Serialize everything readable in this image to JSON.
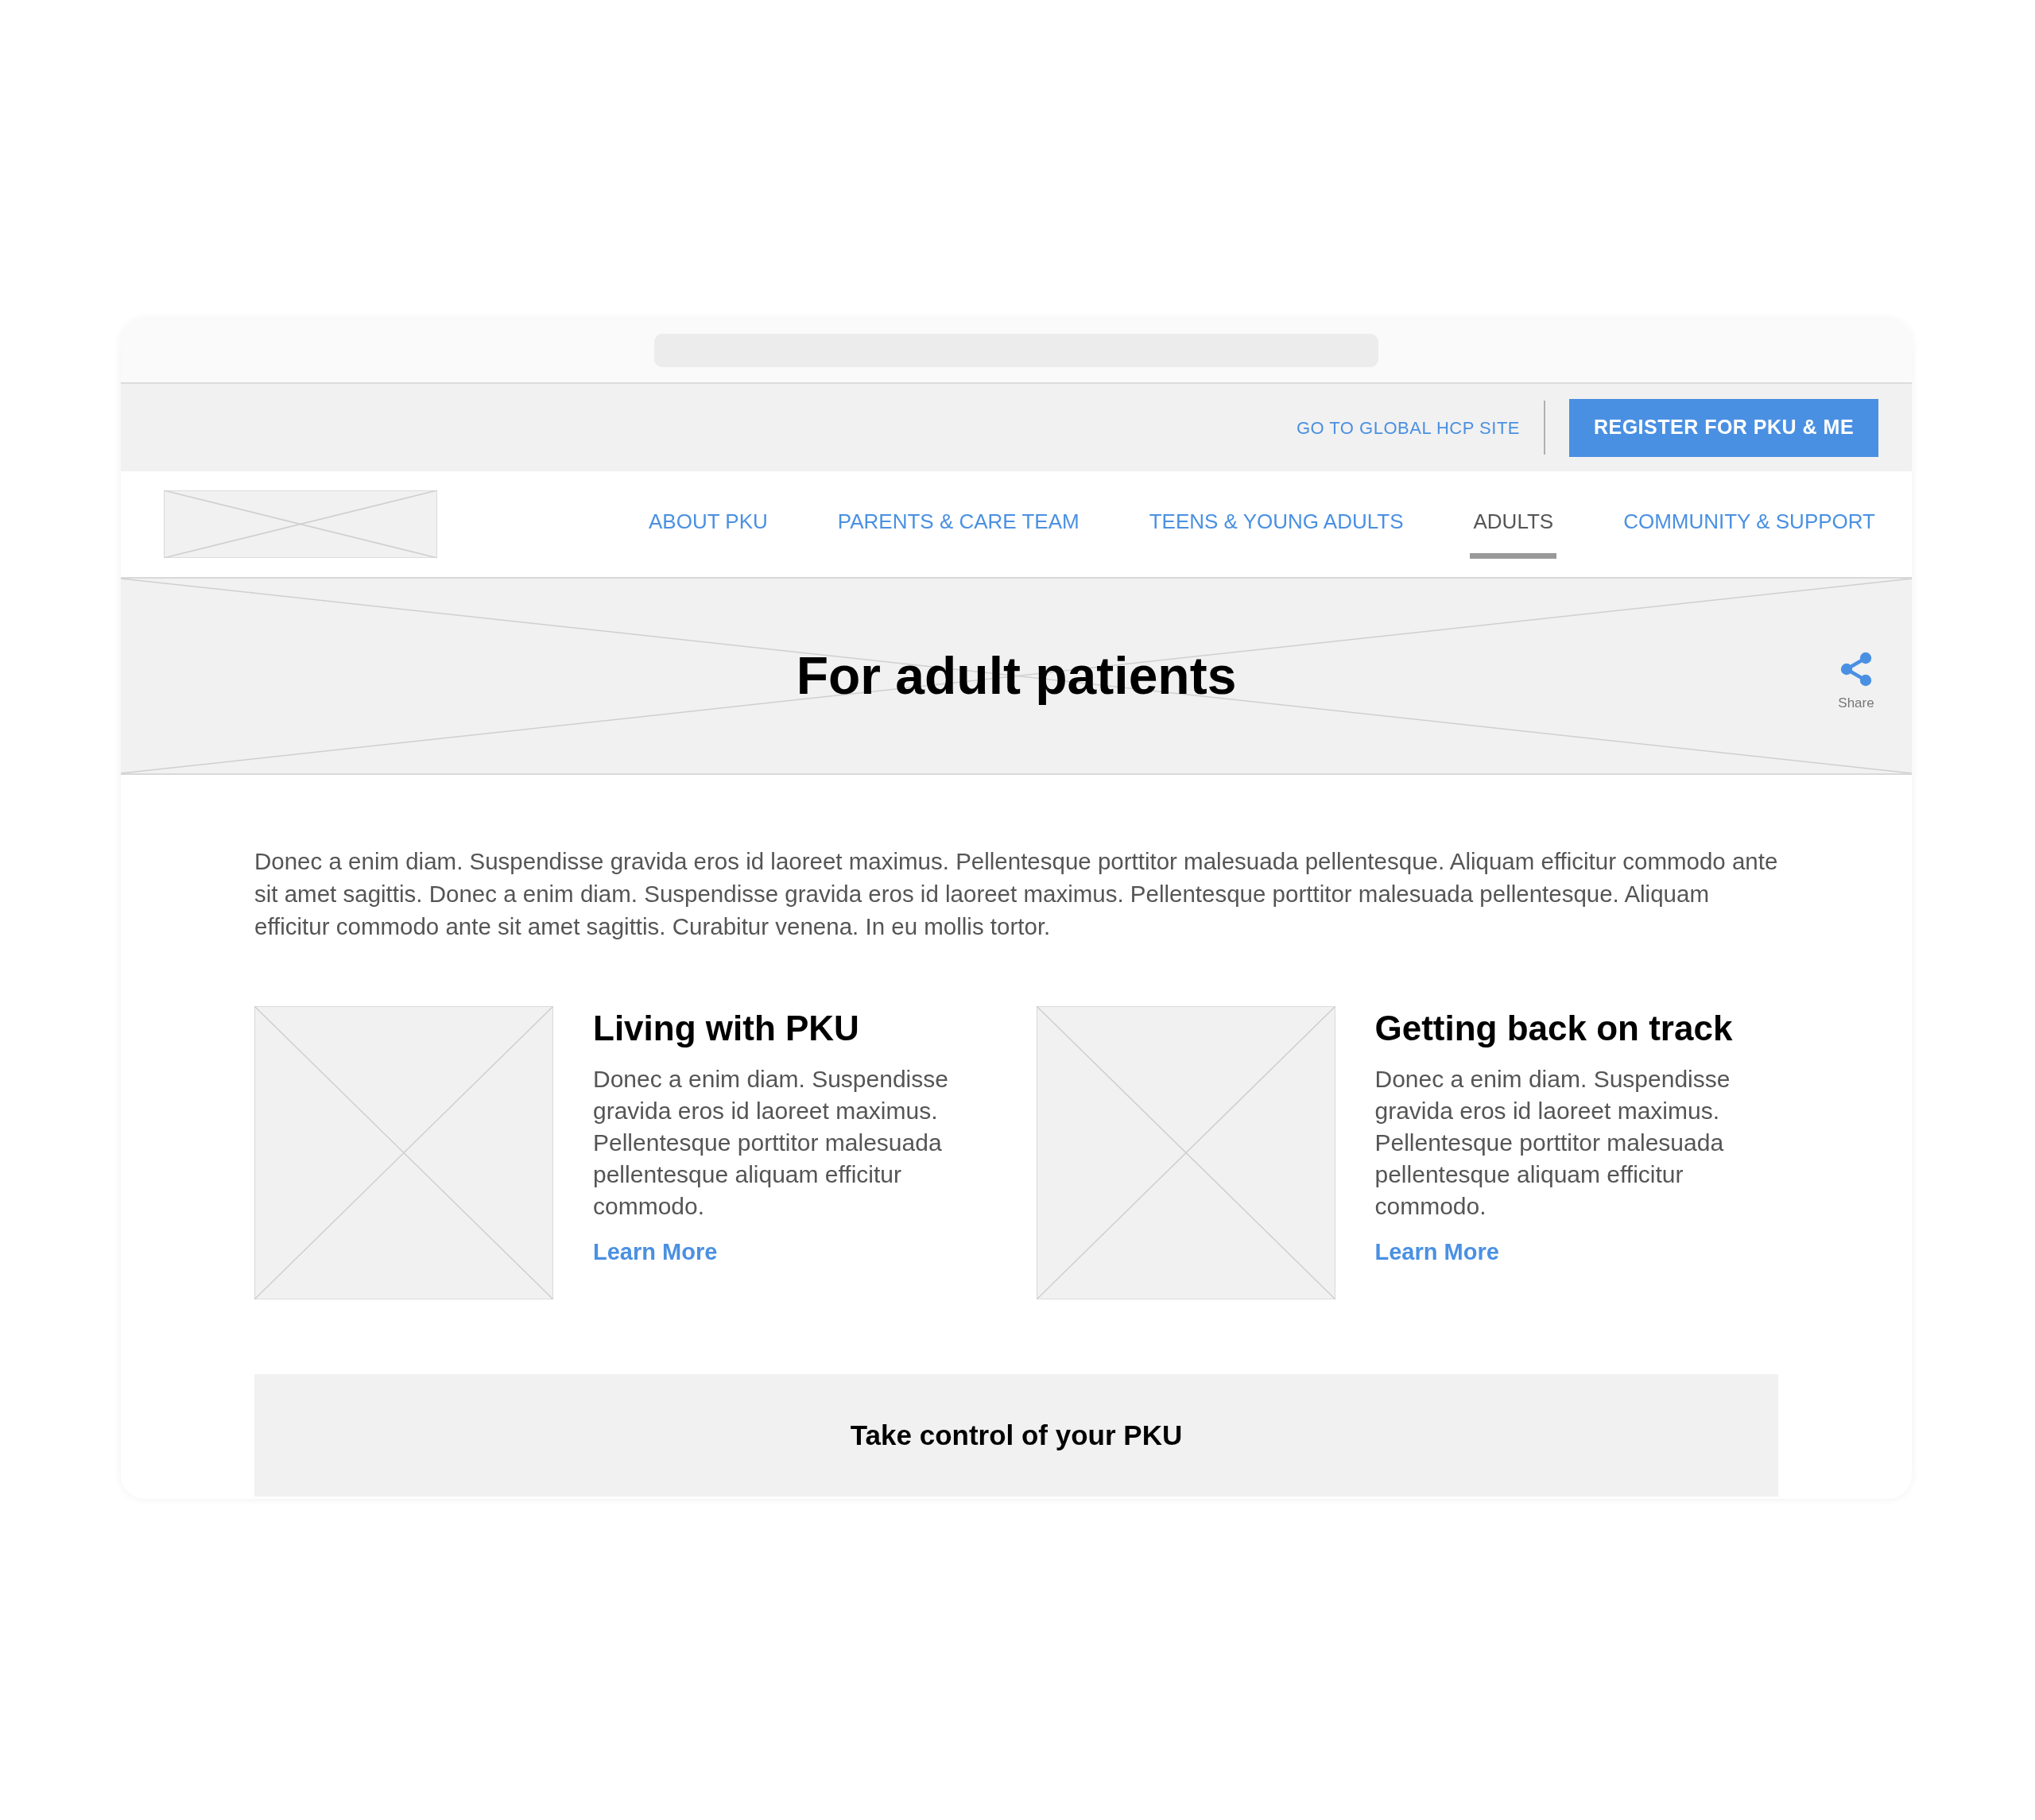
{
  "utility_bar": {
    "link": "GO TO GLOBAL HCP SITE",
    "button": "REGISTER FOR PKU & ME"
  },
  "nav": [
    {
      "label": "ABOUT PKU",
      "selected": false
    },
    {
      "label": "PARENTS & CARE TEAM",
      "selected": false
    },
    {
      "label": "TEENS & YOUNG ADULTS",
      "selected": false
    },
    {
      "label": "ADULTS",
      "selected": true
    },
    {
      "label": "COMMUNITY & SUPPORT",
      "selected": false
    }
  ],
  "hero": {
    "title": "For adult patients",
    "share": "Share"
  },
  "intro": "Donec a enim diam. Suspendisse gravida eros id laoreet maximus. Pellentesque porttitor malesuada pellentesque. Aliquam efficitur commodo ante sit amet sagittis. Donec a enim diam. Suspendisse gravida eros id laoreet maximus. Pellentesque porttitor malesuada pellentesque. Aliquam efficitur commodo ante sit amet sagittis. Curabitur venena. In eu mollis tortor.",
  "cards": [
    {
      "title": "Living with PKU",
      "body": "Donec a enim diam. Suspendisse gravida eros id laoreet maximus. Pellentesque porttitor malesuada pellentesque aliquam efficitur commodo.",
      "link": "Learn More"
    },
    {
      "title": "Getting back on track",
      "body": "Donec a enim diam. Suspendisse gravida eros id laoreet maximus. Pellentesque porttitor malesuada pellentesque aliquam efficitur commodo.",
      "link": "Learn More"
    }
  ],
  "cta": {
    "title": "Take control of your PKU"
  }
}
